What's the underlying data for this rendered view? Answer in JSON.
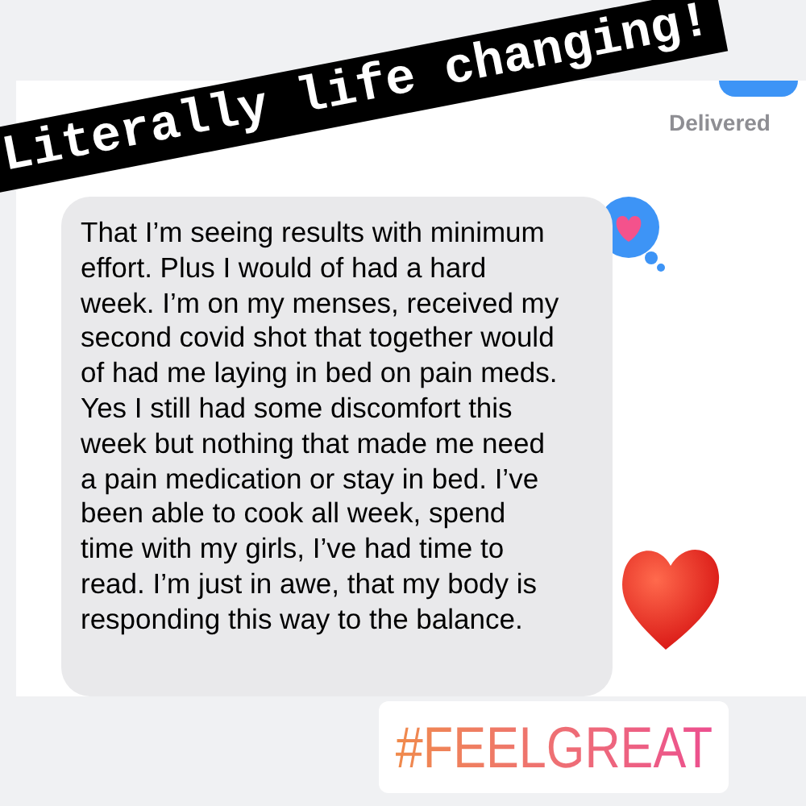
{
  "sticker": {
    "text": "Literally life changing!"
  },
  "status": "Delivered",
  "message": {
    "text": "That I’m seeing results with minimum effort. Plus I would of had a hard week. I’m on my menses, received my second covid shot that together would of had me laying in bed on pain meds. Yes I still had some discomfort this week but nothing that made me need a pain medication or stay in bed. I’ve been able to cook all week, spend time with my girls, I’ve had time to read. I’m just in awe, that my body is responding this way to the balance."
  },
  "hashtag": {
    "text": "#FEELGREAT"
  }
}
